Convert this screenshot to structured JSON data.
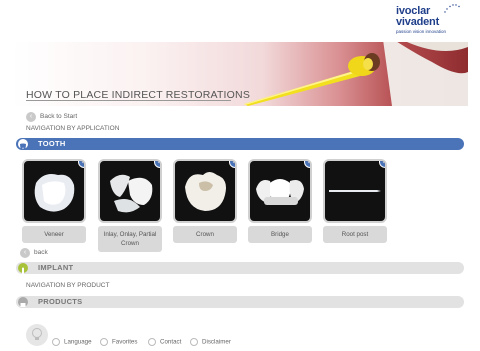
{
  "brand": {
    "line1": "ivoclar",
    "line2": "vivadent",
    "tagline": "passion vision innovation"
  },
  "page": {
    "title": "HOW TO PLACE INDIRECT RESTORATIONS"
  },
  "nav": {
    "back_to_start": "Back to Start",
    "by_application": "NAVIGATION BY APPLICATION",
    "back": "back",
    "by_product": "NAVIGATION BY PRODUCT"
  },
  "sections": {
    "tooth": "TOOTH",
    "implant": "IMPLANT",
    "products": "PRODUCTS"
  },
  "cards": [
    {
      "label": "Veneer",
      "icon": "veneer-image"
    },
    {
      "label": "Inlay, Onlay, Partial Crown",
      "icon": "inlay-image"
    },
    {
      "label": "Crown",
      "icon": "crown-image"
    },
    {
      "label": "Bridge",
      "icon": "bridge-image"
    },
    {
      "label": "Root post",
      "icon": "root-post-image"
    }
  ],
  "footer": {
    "language": "Language",
    "favorites": "Favorites",
    "contact": "Contact",
    "disclaimer": "Disclaimer"
  },
  "colors": {
    "accent": "#4a73b8",
    "implant": "#a8c23a",
    "bar": "#e2e2e2"
  }
}
